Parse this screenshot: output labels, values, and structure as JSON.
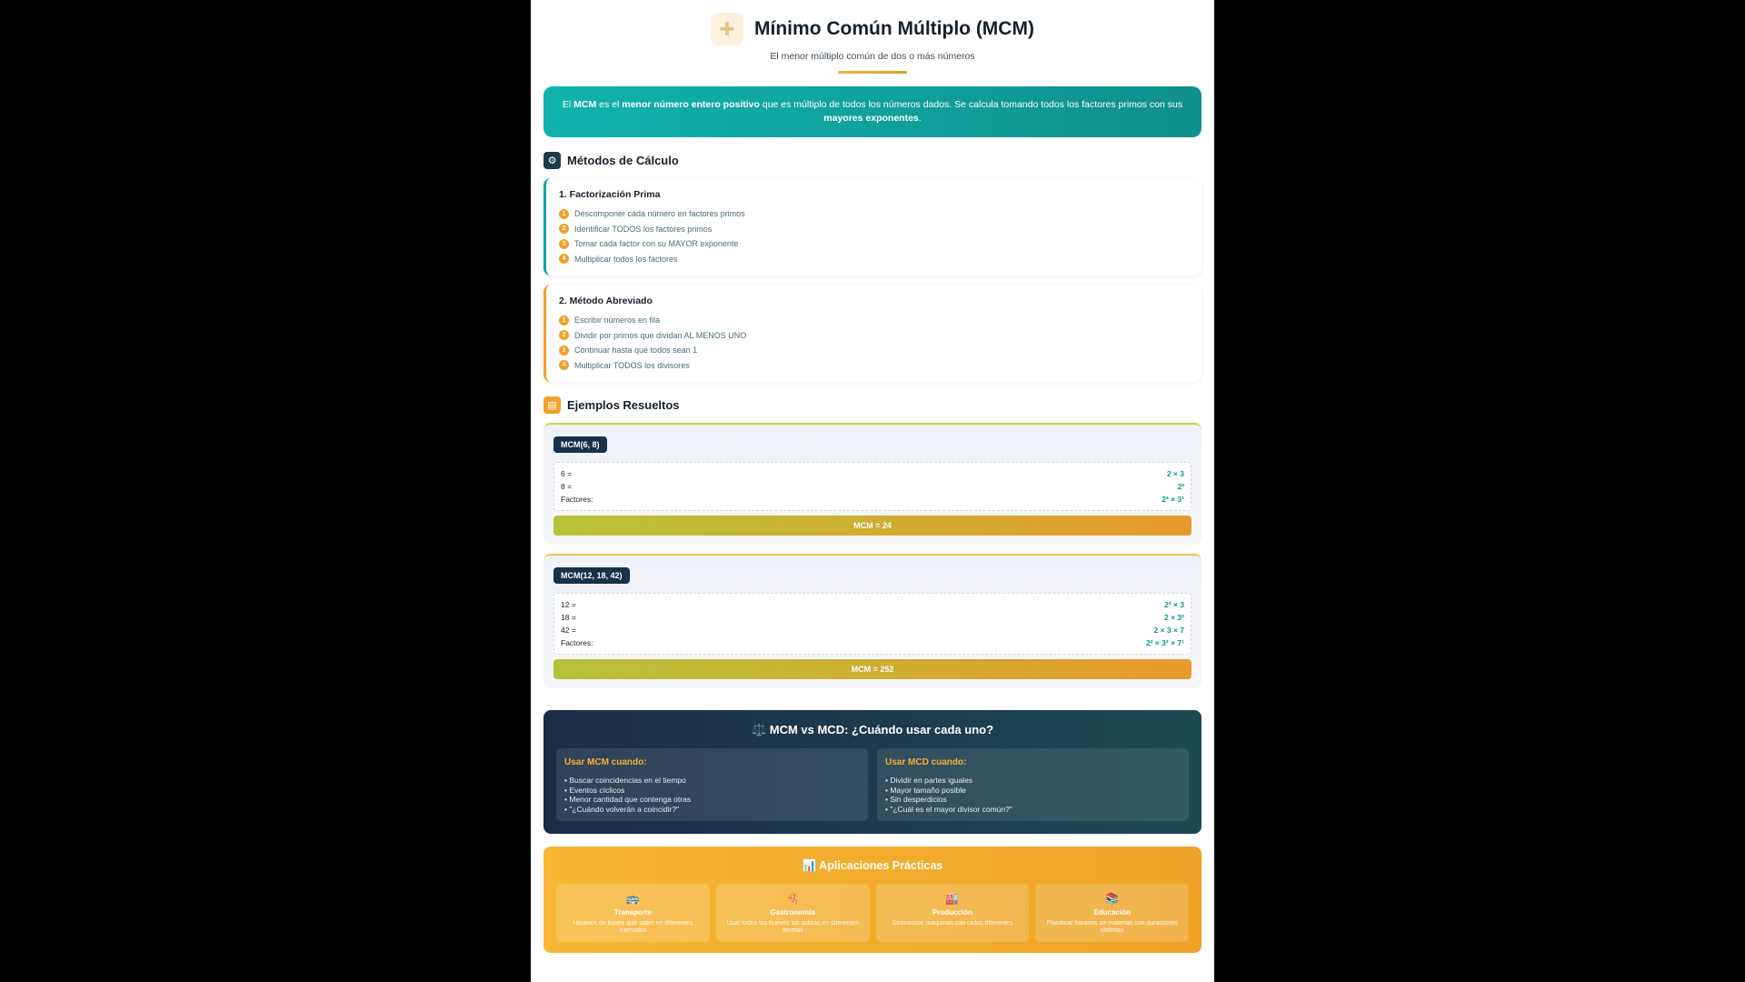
{
  "header": {
    "icon": "puzzle-icon",
    "title": "Mínimo Común Múltiplo (MCM)",
    "subtitle": "El menor múltiplo común de dos o más números"
  },
  "definition": {
    "parts": [
      {
        "text": "El ",
        "bold": false
      },
      {
        "text": "MCM",
        "bold": true
      },
      {
        "text": " es el ",
        "bold": false
      },
      {
        "text": "menor número entero positivo",
        "bold": true
      },
      {
        "text": " que es múltiplo de todos los números dados. Se calcula tomando todos los factores primos con sus ",
        "bold": false
      },
      {
        "text": "mayores exponentes",
        "bold": true
      },
      {
        "text": ".",
        "bold": false
      }
    ]
  },
  "methods": {
    "heading": "Métodos de Cálculo",
    "icon": "gears-icon",
    "cards": [
      {
        "title": "1. Factorización Prima",
        "steps": [
          "Descomponer cada número en factores primos",
          "Identificar TODOS los factores primos",
          "Tomar cada factor con su MAYOR exponente",
          "Multiplicar todos los factores"
        ]
      },
      {
        "title": "2. Método Abreviado",
        "steps": [
          "Escribir números en fila",
          "Dividir por primos que dividan AL MENOS UNO",
          "Continuar hasta que todos sean 1",
          "Multiplicar TODOS los divisores"
        ]
      }
    ]
  },
  "examples": {
    "heading": "Ejemplos Resueltos",
    "icon": "clipboard-icon",
    "items": [
      {
        "badge": "MCM(6, 8)",
        "rows": [
          {
            "label": "6 =",
            "value": "2 × 3"
          },
          {
            "label": "8 =",
            "value": "2³"
          },
          {
            "label": "Factores:",
            "value": "2³ × 3¹"
          }
        ],
        "result": "MCM = 24"
      },
      {
        "badge": "MCM(12, 18, 42)",
        "rows": [
          {
            "label": "12 =",
            "value": "2² × 3"
          },
          {
            "label": "18 =",
            "value": "2 × 3²"
          },
          {
            "label": "42 =",
            "value": "2 × 3 × 7"
          },
          {
            "label": "Factores:",
            "value": "2² × 3² × 7¹"
          }
        ],
        "result": "MCM = 252"
      }
    ]
  },
  "comparison": {
    "title": "⚖️ MCM vs MCD: ¿Cuándo usar cada uno?",
    "columns": [
      {
        "heading": "Usar MCM cuando:",
        "items": [
          "• Buscar coincidencias en el tiempo",
          "• Eventos cíclicos",
          "• Menor cantidad que contenga otras",
          "• \"¿Cuándo volverán a coincidir?\""
        ]
      },
      {
        "heading": "Usar MCD cuando:",
        "items": [
          "• Dividir en partes iguales",
          "• Mayor tamaño posible",
          "• Sin desperdicios",
          "• \"¿Cuál es el mayor divisor común?\""
        ]
      }
    ]
  },
  "applications": {
    "title": "📊 Aplicaciones Prácticas",
    "items": [
      {
        "icon": "🚌",
        "name": "Transporte",
        "desc": "Horarios de buses que salen en diferentes intervalos"
      },
      {
        "icon": "🍕",
        "name": "Gastronomía",
        "desc": "Usar todos los huevos sin sobras en diferentes recetas"
      },
      {
        "icon": "🏭",
        "name": "Producción",
        "desc": "Sincronizar máquinas con ciclos diferentes"
      },
      {
        "icon": "📚",
        "name": "Educación",
        "desc": "Planificar horarios de materias con duraciones distintas"
      }
    ]
  }
}
